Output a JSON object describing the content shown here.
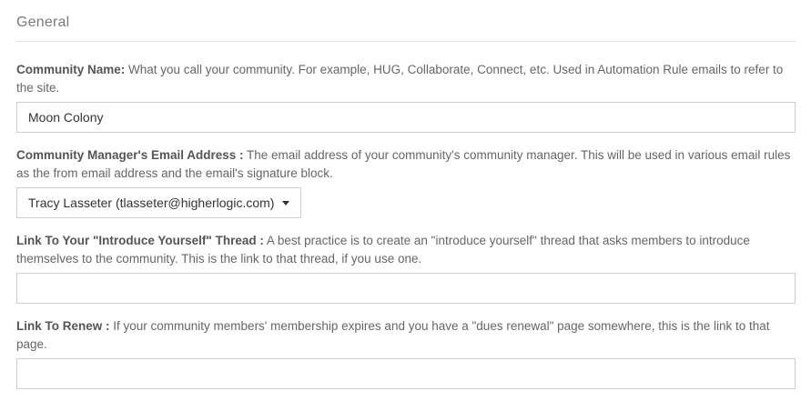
{
  "section": {
    "title": "General"
  },
  "community_name": {
    "label": "Community Name:",
    "description": " What you call your community. For example, HUG, Collaborate, Connect, etc. Used in Automation Rule emails to refer to the site.",
    "value": "Moon Colony"
  },
  "manager_email": {
    "label": "Community Manager's Email Address :",
    "description": " The email address of your community's community manager. This will be used in various email rules as the from email address and the email's signature block.",
    "selected": "Tracy Lasseter (tlasseter@higherlogic.com)"
  },
  "introduce_link": {
    "label": "Link To Your \"Introduce Yourself\" Thread :",
    "description": " A best practice is to create an \"introduce yourself\" thread that asks members to introduce themselves to the community. This is the link to that thread, if you use one.",
    "value": ""
  },
  "renew_link": {
    "label": "Link To Renew :",
    "description": " If your community members' membership expires and you have a \"dues renewal\" page somewhere, this is the link to that page.",
    "value": ""
  },
  "icons": {
    "dropdown": "caret-down-icon"
  }
}
